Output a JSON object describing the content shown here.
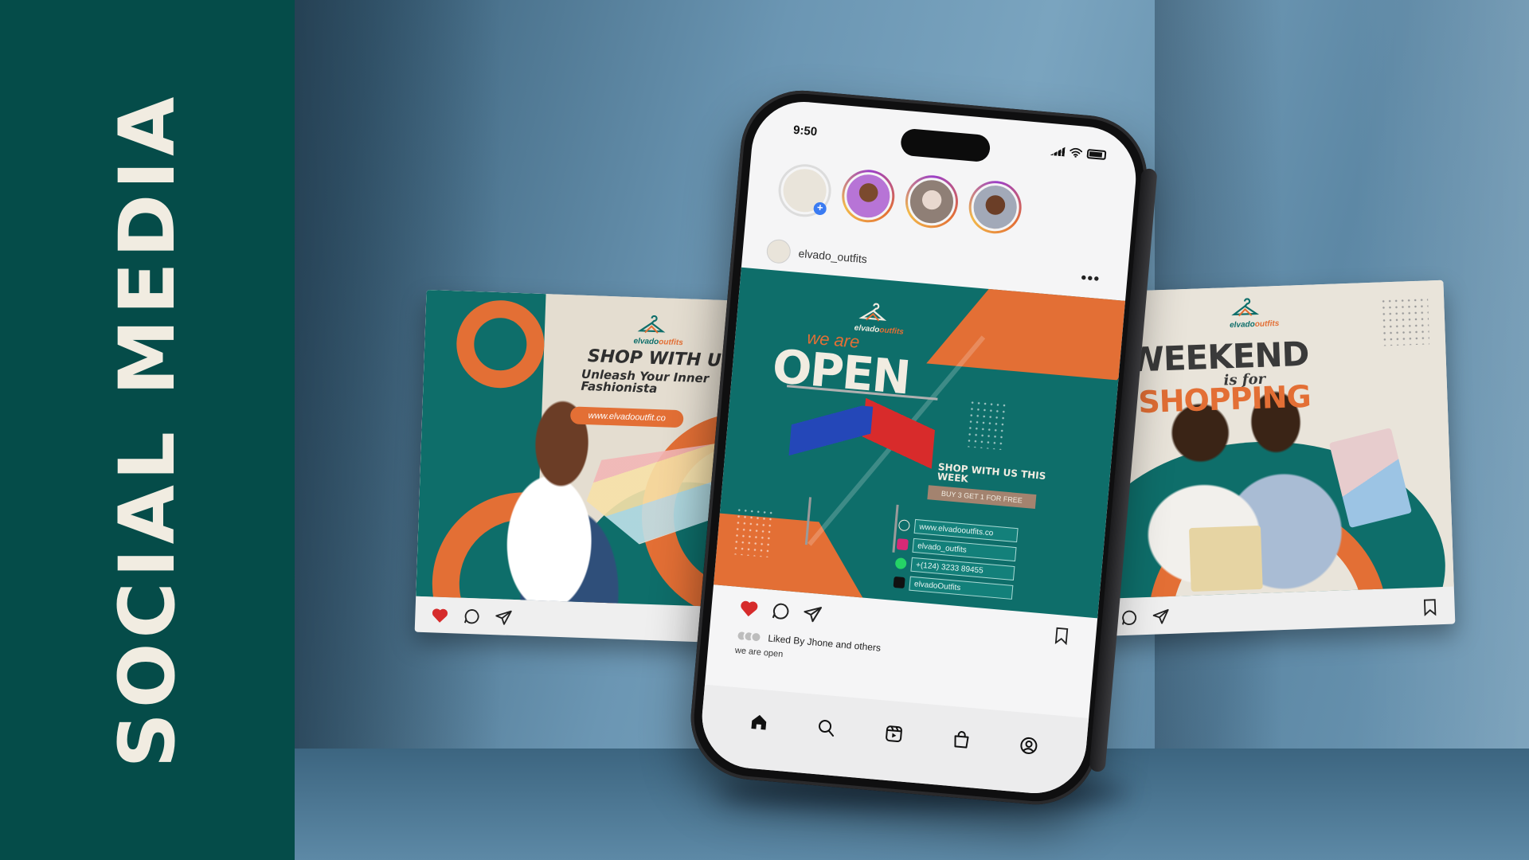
{
  "banner": {
    "title": "SOCIAL MEDIA"
  },
  "brand": {
    "logo_text_a": "elvado",
    "logo_text_b": "outfits"
  },
  "left_post": {
    "headline": "SHOP WITH US",
    "subline": "Unleash Your Inner Fashionista",
    "url": "www.elvadooutfit.co"
  },
  "right_post": {
    "line1": "WEEKEND",
    "line2": "is for",
    "line3": "SHOPPING"
  },
  "phone": {
    "time": "9:50",
    "account_handle": "elvado_outfits",
    "main_post": {
      "kicker": "we are",
      "headline": "OPEN",
      "promo_title": "SHOP WITH US THIS WEEK",
      "offer": "BUY 3 GET 1 FOR FREE",
      "contacts": [
        {
          "icon": "globe-icon",
          "text": "www.elvadooutfits.co",
          "color": "#0e6e6a"
        },
        {
          "icon": "instagram-icon",
          "text": "elvado_outfits",
          "color": "#d62976"
        },
        {
          "icon": "whatsapp-icon",
          "text": "+(124) 3233 89455",
          "color": "#25d366"
        },
        {
          "icon": "tiktok-icon",
          "text": "elvadoOutfits",
          "color": "#111111"
        }
      ]
    },
    "liked_by": "Liked By Jhone and others",
    "caption": "we are open"
  },
  "colors": {
    "teal": "#0e6e6a",
    "orange": "#e36f35",
    "band": "#054c49",
    "heart": "#d62b2b"
  }
}
